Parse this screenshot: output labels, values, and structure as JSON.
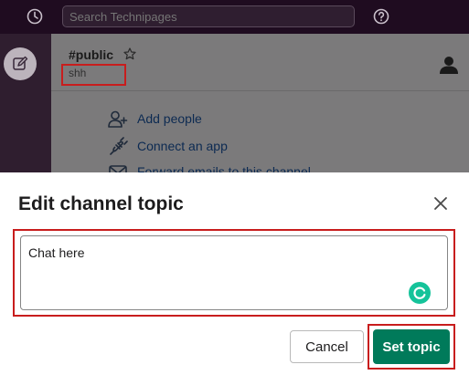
{
  "topbar": {
    "search_placeholder": "Search Technipages",
    "icons": {
      "history": "history-icon",
      "help": "help-icon"
    }
  },
  "sidebar": {
    "compose_icon": "compose-icon"
  },
  "channel": {
    "name": "#public",
    "topic": "shh",
    "star_icon": "star-icon",
    "member_icon": "member-icon"
  },
  "actions": [
    {
      "label": "Add people",
      "icon": "add-person-icon"
    },
    {
      "label": "Connect an app",
      "icon": "plug-icon"
    },
    {
      "label": "Forward emails to this channel",
      "icon": "mail-icon"
    }
  ],
  "modal": {
    "title": "Edit channel topic",
    "topic_value": "Chat here",
    "cancel_label": "Cancel",
    "submit_label": "Set topic"
  },
  "colors": {
    "highlight": "#c81d1d",
    "primary_button": "#007a5a",
    "grammarly": "#15c39a",
    "link_text": "#0c2a52"
  }
}
